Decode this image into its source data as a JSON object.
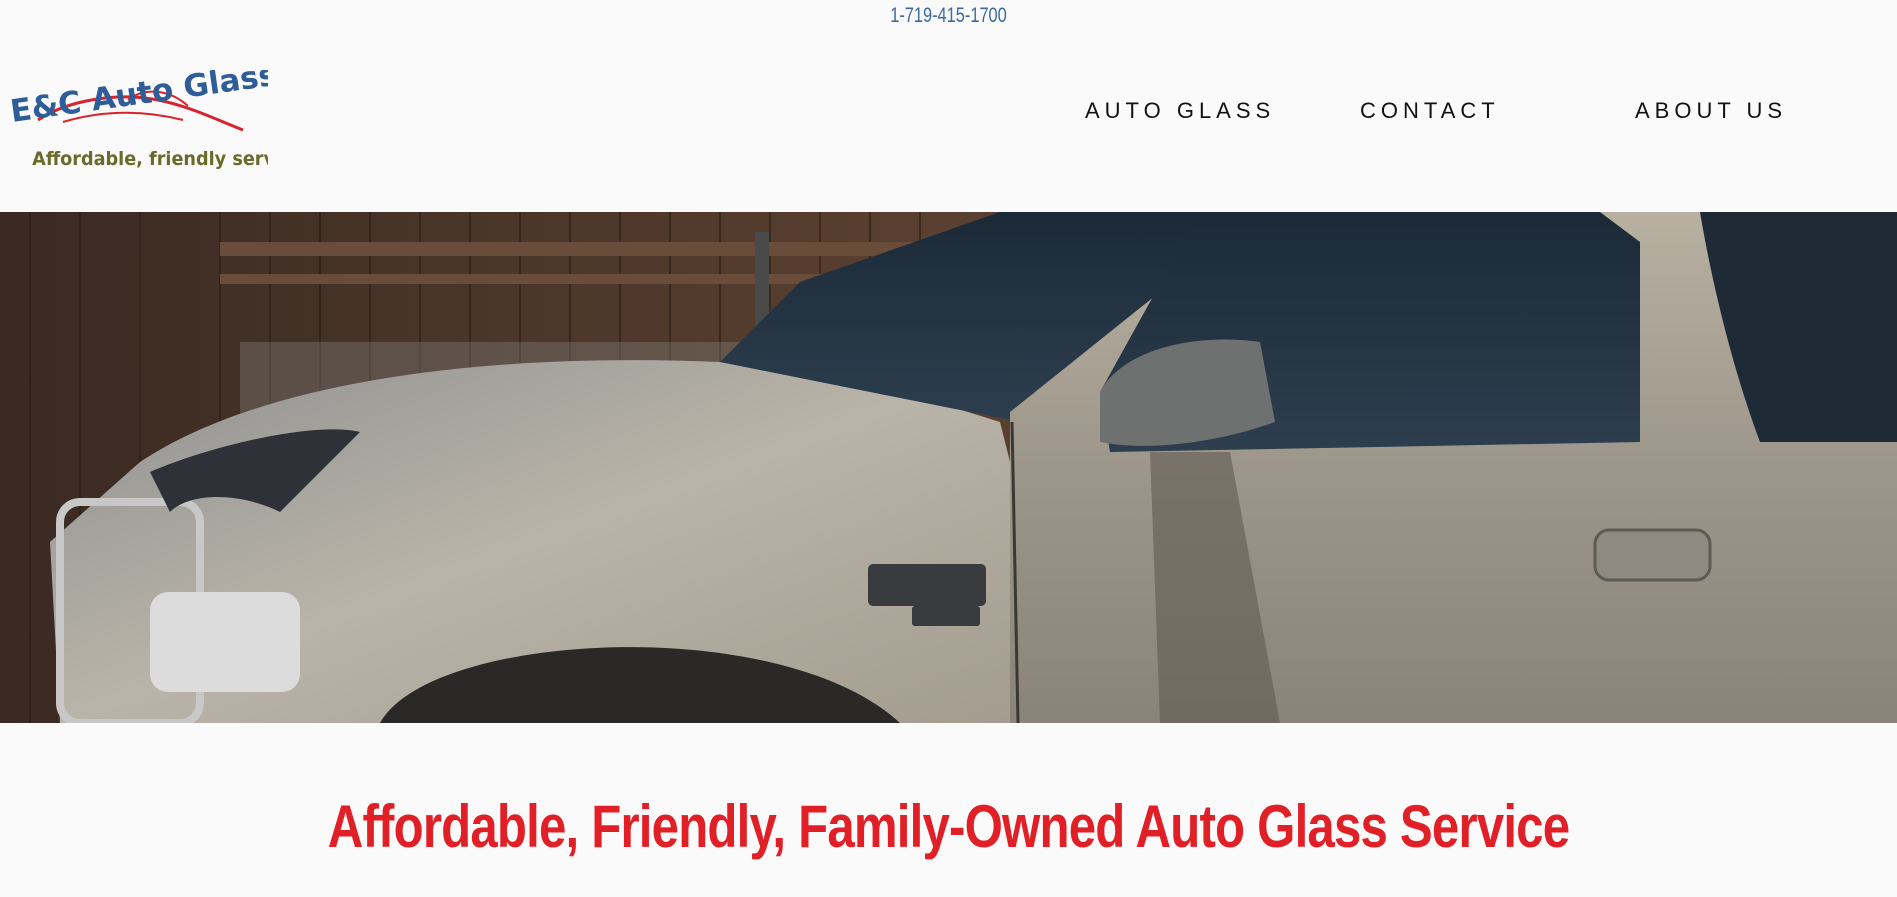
{
  "header": {
    "phone": "1-719-415-1700",
    "logo": {
      "brand_text": "E&C Auto Glass",
      "tagline": "Affordable, friendly service"
    },
    "nav": [
      {
        "label": "AUTO GLASS"
      },
      {
        "label": "CONTACT"
      },
      {
        "label": "ABOUT US"
      }
    ]
  },
  "hero": {
    "image_subject": "truck-photo"
  },
  "main": {
    "headline": "Affordable, Friendly, Family-Owned Auto Glass Service"
  },
  "colors": {
    "background": "#fafafa",
    "phone": "#3b6aa0",
    "headline": "#e11f26",
    "logo_blue": "#2f5d9a",
    "logo_red": "#d8232a",
    "logo_olive": "#6b6a2a"
  }
}
